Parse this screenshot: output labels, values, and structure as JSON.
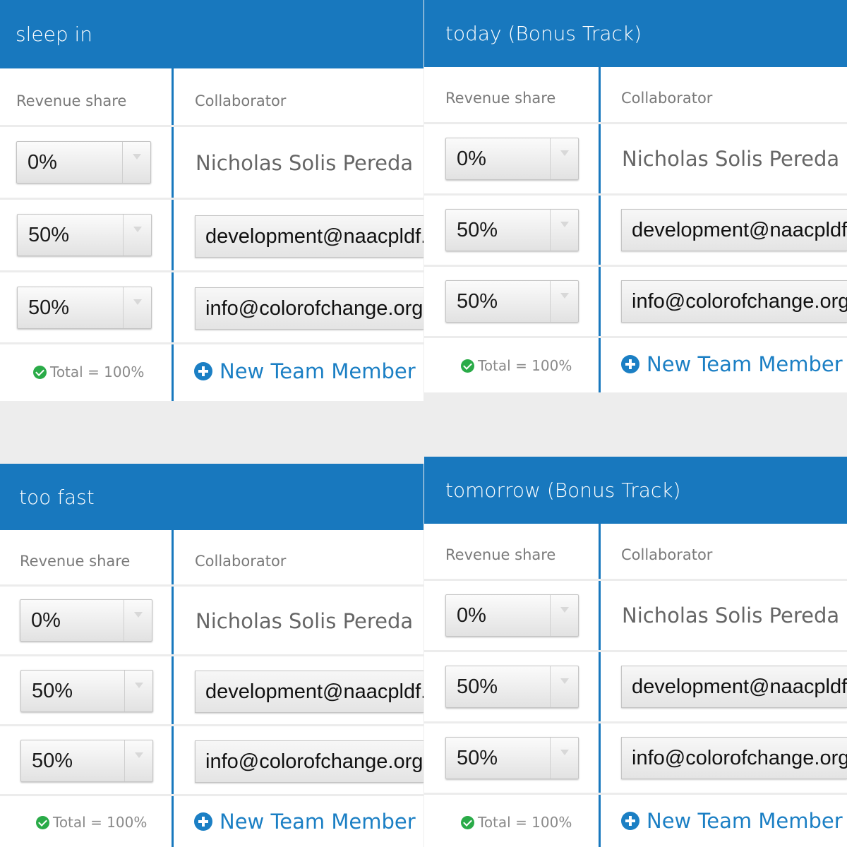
{
  "panels": [
    {
      "title": "sleep in",
      "revenue_share_label": "Revenue share",
      "collaborator_label": "Collaborator",
      "rows": [
        {
          "share": "0%",
          "collaborator": "Nicholas Solis Pereda",
          "type": "name"
        },
        {
          "share": "50%",
          "collaborator": "development@naacpldf.org",
          "type": "email"
        },
        {
          "share": "50%",
          "collaborator": "info@colorofchange.org",
          "type": "email"
        }
      ],
      "total_label": "Total = 100%",
      "new_member_label": "New Team Member"
    },
    {
      "title": "today (Bonus Track)",
      "revenue_share_label": "Revenue share",
      "collaborator_label": "Collaborator",
      "rows": [
        {
          "share": "0%",
          "collaborator": "Nicholas Solis Pereda",
          "type": "name"
        },
        {
          "share": "50%",
          "collaborator": "development@naacpldf.org",
          "type": "email"
        },
        {
          "share": "50%",
          "collaborator": "info@colorofchange.org",
          "type": "email"
        }
      ],
      "total_label": "Total = 100%",
      "new_member_label": "New Team Member"
    },
    {
      "title": "too fast",
      "revenue_share_label": "Revenue share",
      "collaborator_label": "Collaborator",
      "rows": [
        {
          "share": "0%",
          "collaborator": "Nicholas Solis Pereda",
          "type": "name"
        },
        {
          "share": "50%",
          "collaborator": "development@naacpldf.org",
          "type": "email"
        },
        {
          "share": "50%",
          "collaborator": "info@colorofchange.org",
          "type": "email"
        }
      ],
      "total_label": "Total = 100%",
      "new_member_label": "New Team Member"
    },
    {
      "title": "tomorrow (Bonus Track)",
      "revenue_share_label": "Revenue share",
      "collaborator_label": "Collaborator",
      "rows": [
        {
          "share": "0%",
          "collaborator": "Nicholas Solis Pereda",
          "type": "name"
        },
        {
          "share": "50%",
          "collaborator": "development@naacpldf.org",
          "type": "email"
        },
        {
          "share": "50%",
          "collaborator": "info@colorofchange.org",
          "type": "email"
        }
      ],
      "total_label": "Total = 100%",
      "new_member_label": "New Team Member"
    }
  ],
  "colors": {
    "header_blue": "#1878be",
    "link_blue": "#1b7fc4",
    "check_green": "#2aab48",
    "page_gray": "#ededed"
  },
  "icons": [
    "chevron-down-icon",
    "check-icon",
    "plus-circle-icon"
  ]
}
